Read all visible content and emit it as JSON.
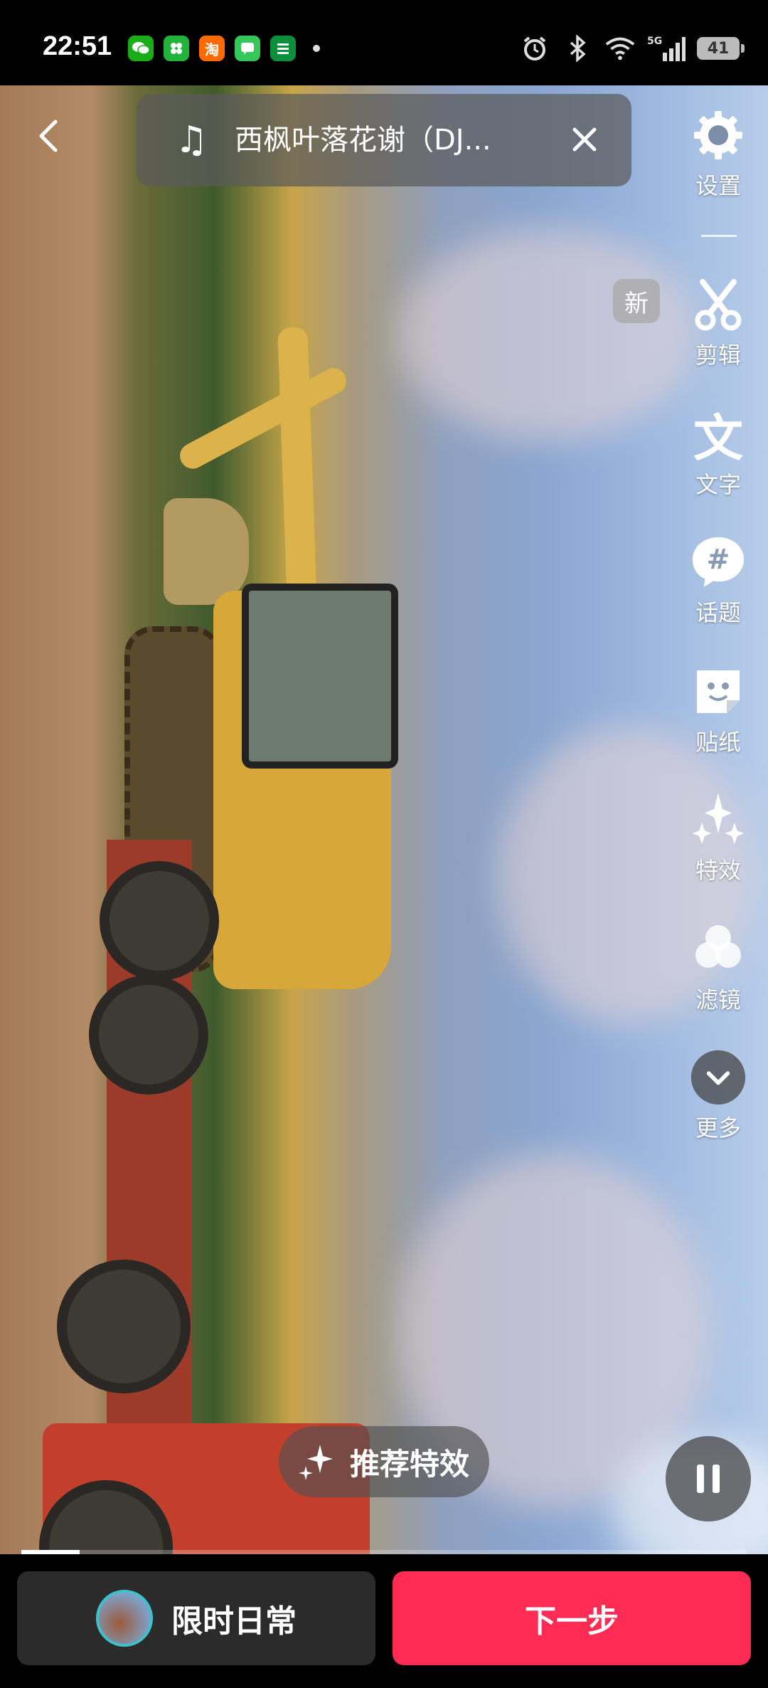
{
  "status_bar": {
    "time": "22:51",
    "network": "5G",
    "battery": "41",
    "app_icons": [
      "wechat-icon",
      "app-green-icon",
      "taobao-icon",
      "messages-icon",
      "post-icon"
    ],
    "taobao_char": "淘"
  },
  "music": {
    "title": "西枫叶落花谢（DJ..."
  },
  "badges": {
    "new": "新"
  },
  "tools": [
    {
      "id": "settings",
      "label": "设置",
      "icon": "gear-icon"
    },
    {
      "id": "edit",
      "label": "剪辑",
      "icon": "scissors-icon"
    },
    {
      "id": "text",
      "label": "文字",
      "icon": "text-icon",
      "glyph": "文"
    },
    {
      "id": "topic",
      "label": "话题",
      "icon": "hashtag-icon",
      "glyph": "#"
    },
    {
      "id": "sticker",
      "label": "贴纸",
      "icon": "sticker-icon"
    },
    {
      "id": "effects",
      "label": "特效",
      "icon": "sparkle-icon"
    },
    {
      "id": "filter",
      "label": "滤镜",
      "icon": "filter-icon"
    },
    {
      "id": "more",
      "label": "更多",
      "icon": "chevron-down-icon"
    }
  ],
  "recommend_effects": "推荐特效",
  "playback": {
    "progress": 0.08
  },
  "bottom": {
    "left_label": "限时日常",
    "right_label": "下一步"
  },
  "colors": {
    "primary": "#fe2c55",
    "avatar_ring": "#3fc1c9"
  }
}
